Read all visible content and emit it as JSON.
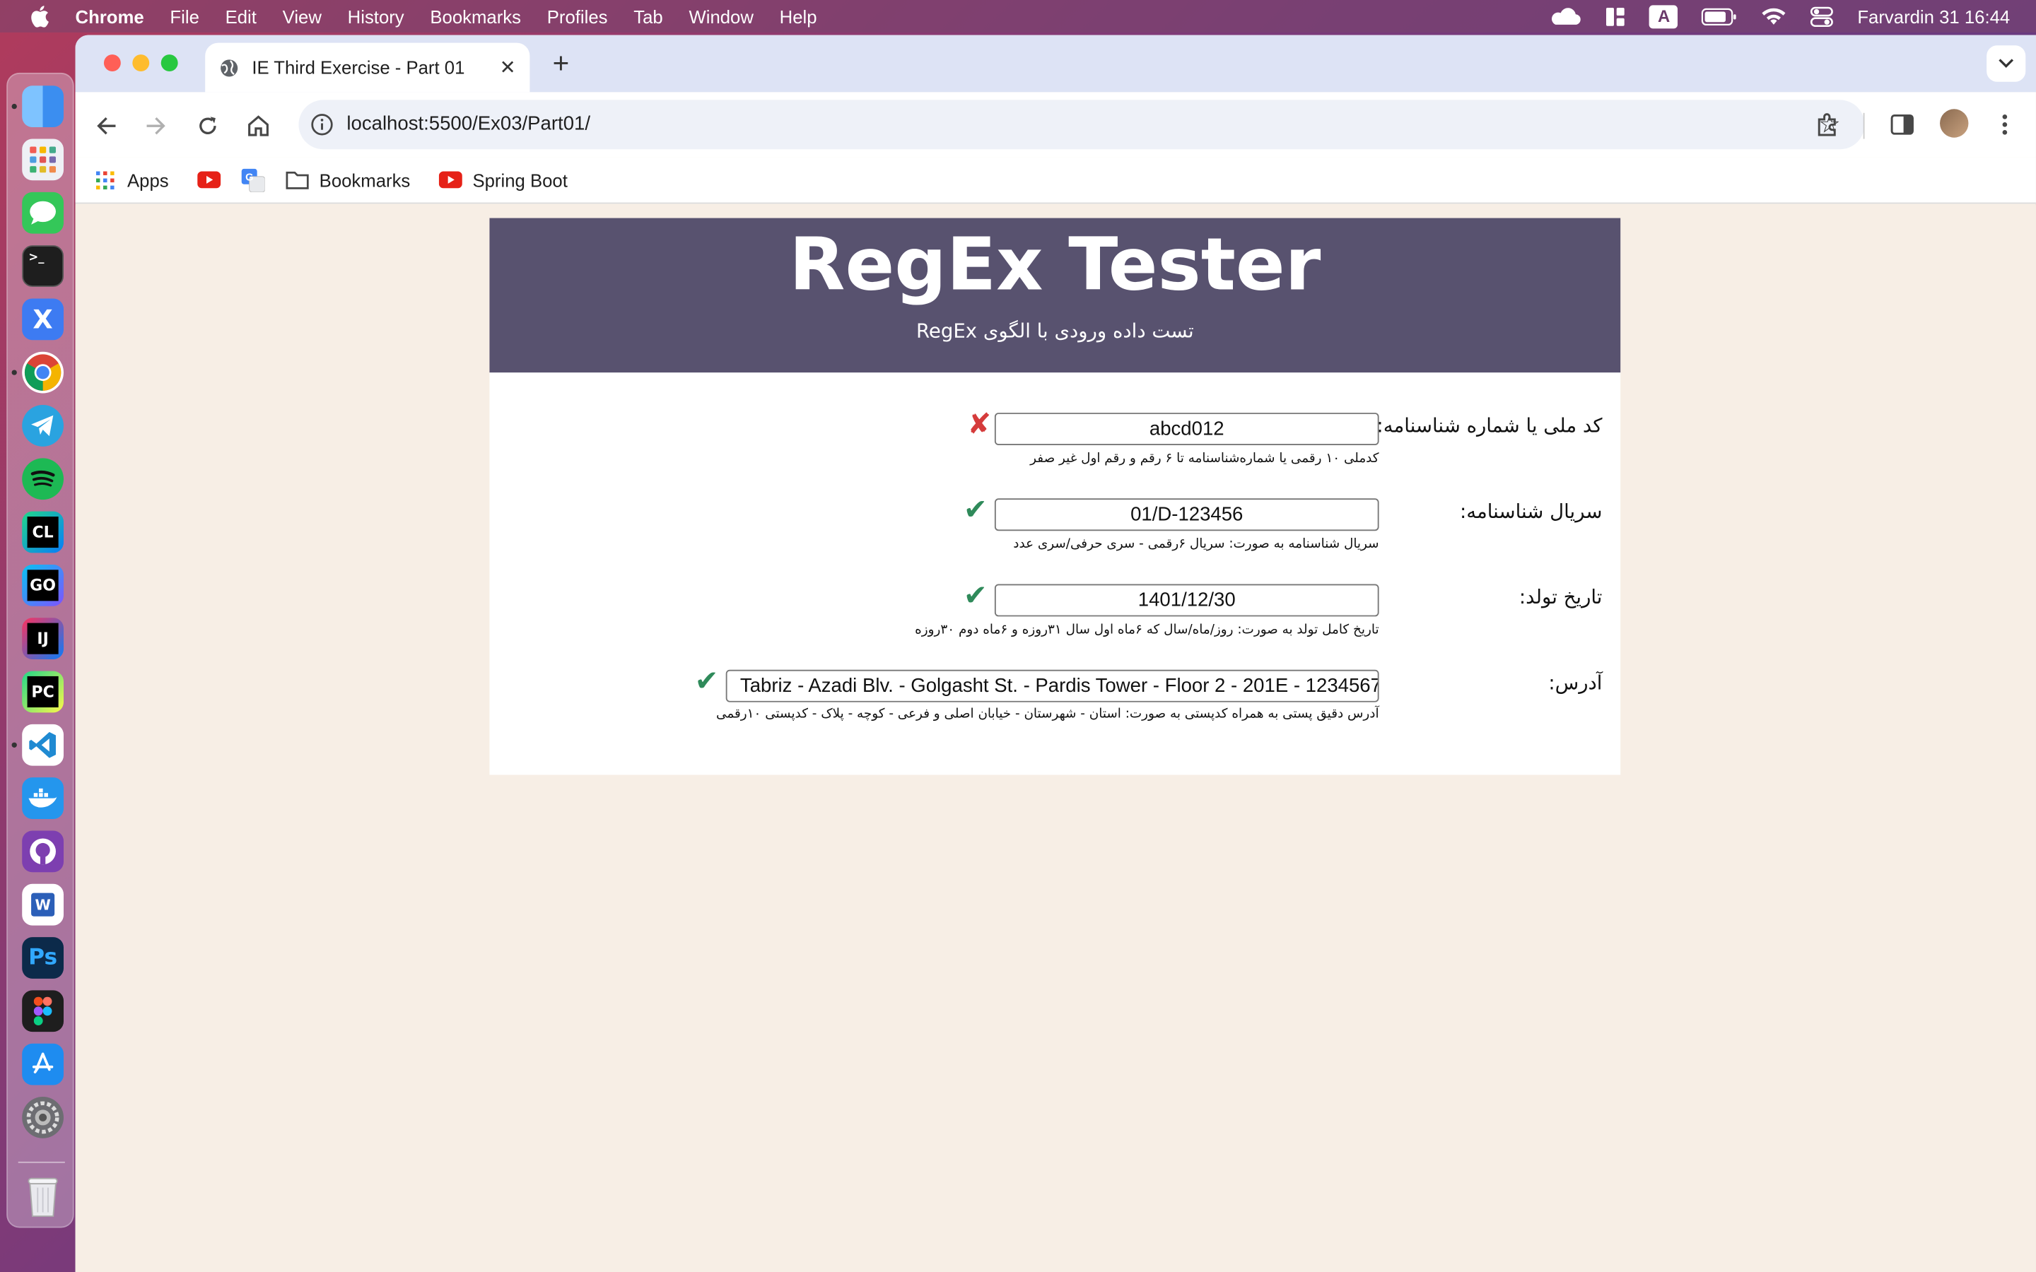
{
  "menubar": {
    "app_name": "Chrome",
    "items": [
      "File",
      "Edit",
      "View",
      "History",
      "Bookmarks",
      "Profiles",
      "Tab",
      "Window",
      "Help"
    ],
    "input_source": "A",
    "clock": "Farvardin 31  16:44"
  },
  "dock": {
    "apps": [
      {
        "name": "finder",
        "bg": "#3b8ef0",
        "glyph": ""
      },
      {
        "name": "launchpad",
        "bg": "#e9e9ef",
        "glyph": ""
      },
      {
        "name": "messages",
        "bg": "#34c759",
        "glyph": ""
      },
      {
        "name": "terminal",
        "bg": "#1e1e1e",
        "glyph": ">_"
      },
      {
        "name": "xcode-like",
        "bg": "#3d7bf2",
        "glyph": "X"
      },
      {
        "name": "chrome",
        "bg": "#ffffff",
        "glyph": ""
      },
      {
        "name": "telegram",
        "bg": "#2aa3e0",
        "glyph": ""
      },
      {
        "name": "spotify",
        "bg": "#1db954",
        "glyph": ""
      },
      {
        "name": "clion",
        "bg": "#1c8a6a",
        "glyph": "CL"
      },
      {
        "name": "goland",
        "bg": "#3066d8",
        "glyph": "GO"
      },
      {
        "name": "intellij",
        "bg": "#e04a7e",
        "glyph": "IJ"
      },
      {
        "name": "pycharm",
        "bg": "#1aa260",
        "glyph": "PC"
      },
      {
        "name": "vscode",
        "bg": "#ffffff",
        "glyph": ""
      },
      {
        "name": "docker",
        "bg": "#2496ed",
        "glyph": ""
      },
      {
        "name": "github-desktop",
        "bg": "#7d3fb0",
        "glyph": ""
      },
      {
        "name": "word",
        "bg": "#2b5fb8",
        "glyph": "W"
      },
      {
        "name": "photoshop",
        "bg": "#0c2a4a",
        "glyph": "Ps"
      },
      {
        "name": "figma",
        "bg": "#1e1e1e",
        "glyph": ""
      },
      {
        "name": "app-store",
        "bg": "#1e8cf0",
        "glyph": ""
      },
      {
        "name": "system-settings",
        "bg": "#6d6d72",
        "glyph": ""
      }
    ]
  },
  "browser": {
    "tab_title": "IE Third Exercise - Part 01",
    "url": "localhost:5500/Ex03/Part01/",
    "bookmarks": [
      "Apps",
      "",
      "",
      "Bookmarks",
      "Spring Boot"
    ]
  },
  "page": {
    "title": "RegEx Tester",
    "subtitle": "تست داده ورودی با الگوی RegEx",
    "fields": [
      {
        "label": "کد ملی یا شماره شناسنامه:",
        "value": "abcd012",
        "hint": "کدملی ۱۰ رقمی یا شماره‌شناسنامه تا ۶ رقم و رقم اول غیر صفر",
        "valid": false,
        "mark": "✘"
      },
      {
        "label": "سریال شناسنامه:",
        "value": "01/D-123456",
        "hint": "سریال شناسنامه به صورت: سریال ۶رقمی - سری حرفی/سری عدد",
        "valid": true,
        "mark": "✔"
      },
      {
        "label": "تاریخ تولد:",
        "value": "1401/12/30",
        "hint": "تاریخ کامل تولد به صورت: روز/ماه/سال که ۶ماه اول سال ۳۱روزه و ۶ماه دوم ۳۰روزه",
        "valid": true,
        "mark": "✔"
      },
      {
        "label": "آدرس:",
        "value": "Tabriz - Azadi Blv. - Golgasht St. - Pardis Tower - Floor 2 - 201E - 1234567",
        "hint": "آدرس دقیق پستی به همراه کدپستی به صورت: استان - شهرستان - خیابان اصلی و فرعی - کوچه - پلاک - کدپستی ۱۰رقمی",
        "valid": true,
        "mark": "✔"
      }
    ]
  }
}
